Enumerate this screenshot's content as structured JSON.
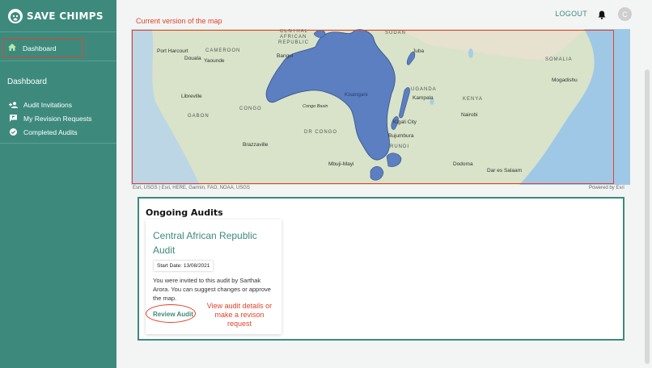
{
  "app": {
    "name": "SAVE CHIMPS"
  },
  "sidebar": {
    "primary_item": {
      "label": "Dashboard",
      "icon": "home-icon"
    },
    "section_title": "Dashboard",
    "items": [
      {
        "label": "Audit Invitations",
        "icon": "person-add-icon"
      },
      {
        "label": "My Revision Requests",
        "icon": "flag-message-icon"
      },
      {
        "label": "Completed Audits",
        "icon": "check-circle-icon"
      }
    ]
  },
  "topbar": {
    "logout_label": "LOGOUT",
    "avatar_initial": "C"
  },
  "map": {
    "annotation": "Current version of the map",
    "attribution": "Esri, USGS | Esri, HERE, Garmin, FAO, NOAA, USGS",
    "powered_by": "Powered by Esri",
    "countries": [
      "CENTRAL",
      "AFRICAN",
      "REPUBLIC",
      "SUDAN",
      "SOMALIA",
      "CAMEROON",
      "GABON",
      "CONGO",
      "DR CONGO",
      "UGANDA",
      "KENYA",
      "RUNDI"
    ],
    "cities": [
      "Port Harcourt",
      "Douala",
      "Yaounde",
      "Libreville",
      "Brazzaville",
      "Kinshasa",
      "Mbuji-Mayi",
      "Kampala",
      "Nairobi",
      "Kigali City",
      "Bujumbura",
      "Dodoma",
      "Dar es Salaam",
      "Mogadishu",
      "Juba",
      "Bangui",
      "Kisangani",
      "Congo Basin"
    ],
    "colors": {
      "highlight": "#5b7fc0",
      "land": "#d7e1c8",
      "water": "#a8cde6"
    }
  },
  "audits": {
    "title": "Ongoing Audits",
    "card": {
      "title": "Central African Republic Audit",
      "start_date": "Start Date: 13/08/2021",
      "body": "You were invited to this audit by Sarthak Arora. You can suggest changes or approve the map.",
      "link_label": "Review Audit"
    },
    "annotation": "View audit details or make a revison request"
  },
  "colors": {
    "brand": "#3d8a7d",
    "annotation": "#e0432b"
  }
}
